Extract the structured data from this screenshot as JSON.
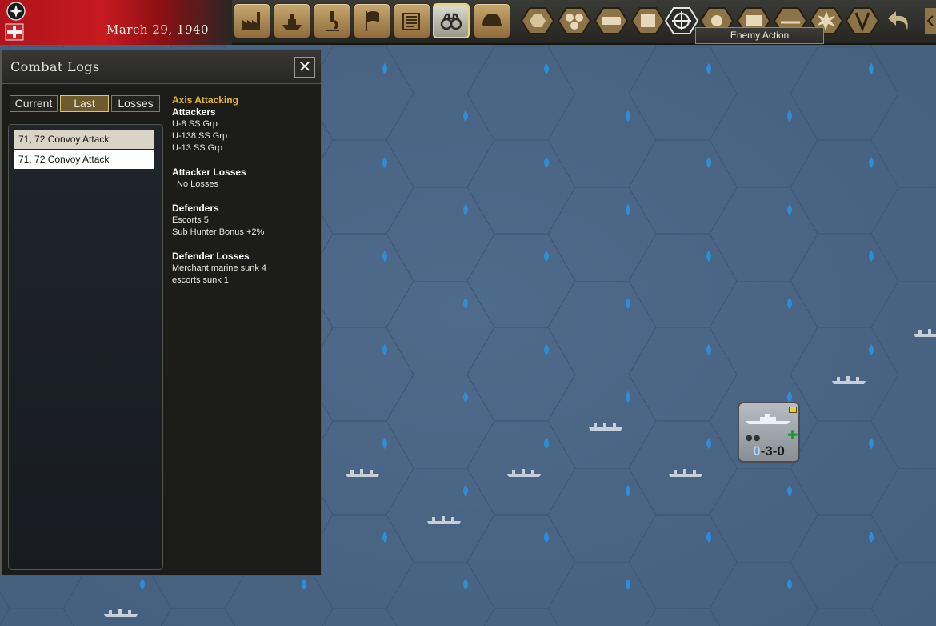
{
  "header": {
    "date": "March 29, 1940"
  },
  "toolbar": {
    "buttons": [
      {
        "name": "production",
        "icon": "factory-icon"
      },
      {
        "name": "naval",
        "icon": "ship-icon"
      },
      {
        "name": "research",
        "icon": "microscope-icon"
      },
      {
        "name": "diplomacy",
        "icon": "flag-icon"
      },
      {
        "name": "reports",
        "icon": "newspaper-icon"
      },
      {
        "name": "intelligence",
        "icon": "binoculars-icon",
        "active": true
      },
      {
        "name": "military",
        "icon": "helmet-icon"
      }
    ],
    "map_filters": [
      "hex-icon",
      "hex-cluster-icon",
      "rail-icon",
      "coins-icon",
      "target-icon",
      "sun-icon",
      "envelope-icon",
      "ruins-icon",
      "explosion-icon",
      "victory-icon",
      "undo-icon"
    ],
    "tooltip": "Enemy Action"
  },
  "combat_logs": {
    "title": "Combat Logs",
    "close_label": "✕",
    "tabs": [
      "Current",
      "Last",
      "Losses"
    ],
    "active_tab": "Last",
    "entries": [
      "71, 72 Convoy Attack",
      "71, 72 Convoy Attack"
    ],
    "selected_entry": 0,
    "details": {
      "side": "Axis Attacking",
      "attackers_label": "Attackers",
      "attackers": [
        "U-8 SS Grp",
        "U-138 SS Grp",
        "U-13 SS Grp"
      ],
      "attacker_losses_label": "Attacker Losses",
      "attacker_losses": [
        "No Losses"
      ],
      "defenders_label": "Defenders",
      "defenders": [
        "Escorts 5",
        "Sub Hunter Bonus +2%"
      ],
      "defender_losses_label": "Defender Losses",
      "defender_losses": [
        "Merchant marine sunk 4",
        "escorts sunk 1"
      ]
    }
  },
  "unit": {
    "type": "surface-ship-icon",
    "strength_first": "0",
    "strength_rest": "-3-0"
  },
  "colors": {
    "sea": "#4a6585",
    "hex_line": "#3f5878",
    "accent_gold": "#e8b82c"
  }
}
